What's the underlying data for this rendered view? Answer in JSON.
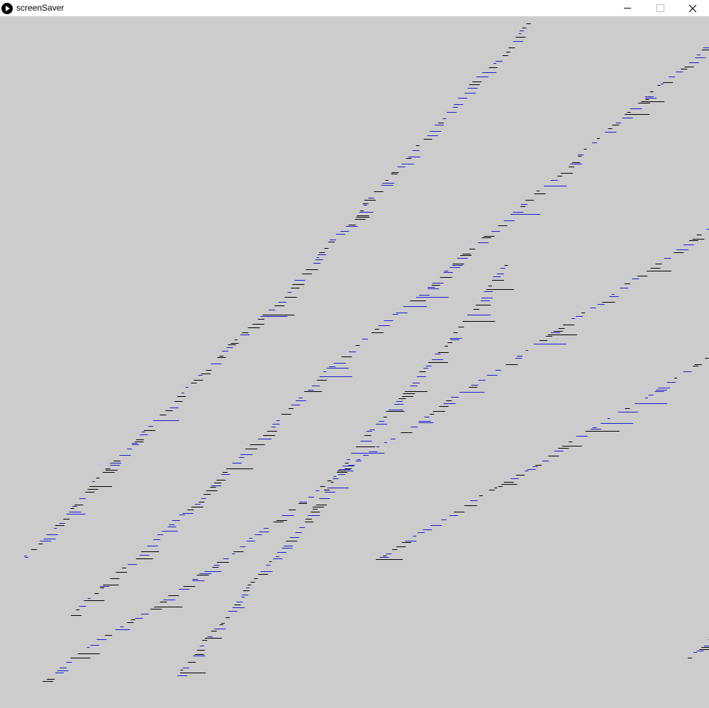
{
  "window": {
    "title": "screenSaver",
    "app_icon": "play-icon",
    "controls": [
      "minimize-icon",
      "maximize-icon",
      "close-icon"
    ]
  },
  "canvas": {
    "background_color": "#cccccc",
    "stroke_colors": [
      "#000000",
      "#1a1ad0"
    ]
  }
}
